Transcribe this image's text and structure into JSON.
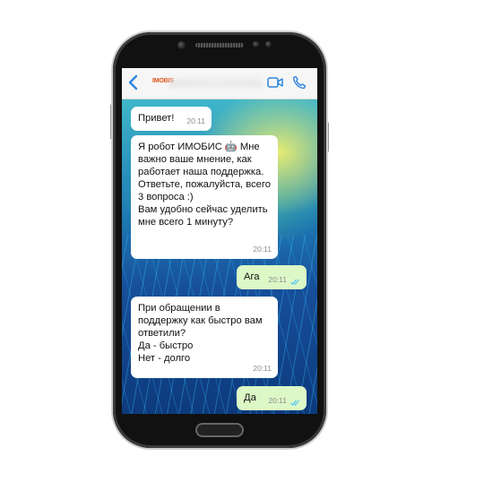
{
  "header": {
    "brand_logo": "IMOBIS"
  },
  "messages": [
    {
      "direction": "incoming",
      "text": "Привет!",
      "time": "20:11"
    },
    {
      "direction": "incoming",
      "text": "Я робот ИМОБИС 🤖 Мне важно ваше мнение, как работает наша поддержка. Ответьте, пожалуйста, всего 3 вопроса :)\nВам удобно сейчас уделить мне всего 1 минуту?",
      "time": "20:11"
    },
    {
      "direction": "outgoing",
      "text": "Ага",
      "time": "20:11",
      "read": true
    },
    {
      "direction": "incoming",
      "text": " При обращении в поддержку как быстро вам ответили?\nДа - быстро\nНет - долго",
      "time": "20:11"
    },
    {
      "direction": "outgoing",
      "text": "Да",
      "time": "20:11",
      "read": true
    }
  ],
  "icons": {
    "back": "chevron-left-icon",
    "video": "video-camera-icon",
    "call": "phone-icon",
    "read_receipt": "double-check-icon"
  },
  "colors": {
    "accent": "#2e86de",
    "incoming_bubble": "#ffffff",
    "outgoing_bubble": "#dcf8c6",
    "read_check": "#4fc3f7",
    "brand": "#e0551b"
  }
}
